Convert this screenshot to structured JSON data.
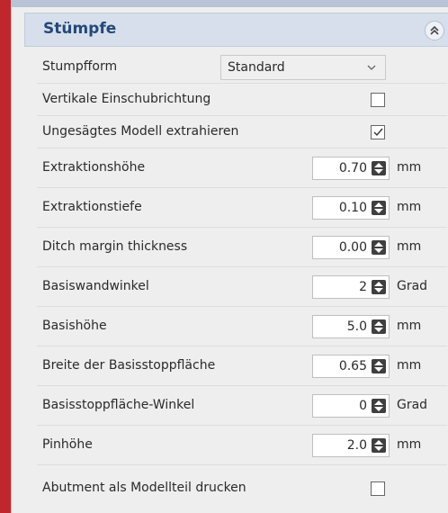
{
  "panel": {
    "title": "Stümpfe",
    "collapse_icon": "chevron-double-up-icon"
  },
  "rows": [
    {
      "label": "Stumpfform",
      "type": "combo",
      "value": "Standard"
    },
    {
      "label": "Vertikale Einschubrichtung",
      "type": "checkbox",
      "checked": false
    },
    {
      "label": "Ungesägtes Modell extrahieren",
      "type": "checkbox",
      "checked": true
    },
    {
      "label": "Extraktionshöhe",
      "type": "spin",
      "value": "0.70",
      "unit": "mm"
    },
    {
      "label": "Extraktionstiefe",
      "type": "spin",
      "value": "0.10",
      "unit": "mm"
    },
    {
      "label": "Ditch margin thickness",
      "type": "spin",
      "value": "0.00",
      "unit": "mm"
    },
    {
      "label": "Basiswandwinkel",
      "type": "spin",
      "value": "2",
      "unit": "Grad"
    },
    {
      "label": "Basishöhe",
      "type": "spin",
      "value": "5.0",
      "unit": "mm"
    },
    {
      "label": "Breite der Basisstoppfläche",
      "type": "spin",
      "value": "0.65",
      "unit": "mm"
    },
    {
      "label": "Basisstoppfläche-Winkel",
      "type": "spin",
      "value": "0",
      "unit": "Grad"
    },
    {
      "label": "Pinhöhe",
      "type": "spin",
      "value": "2.0",
      "unit": "mm"
    },
    {
      "label": "Abutment als Modellteil drucken",
      "type": "checkbox",
      "checked": false
    }
  ],
  "colors": {
    "accent_strip": "#c0272d",
    "header_bg": "#d6dfeb",
    "header_text": "#25487a",
    "panel_bg": "#eeeeee"
  }
}
